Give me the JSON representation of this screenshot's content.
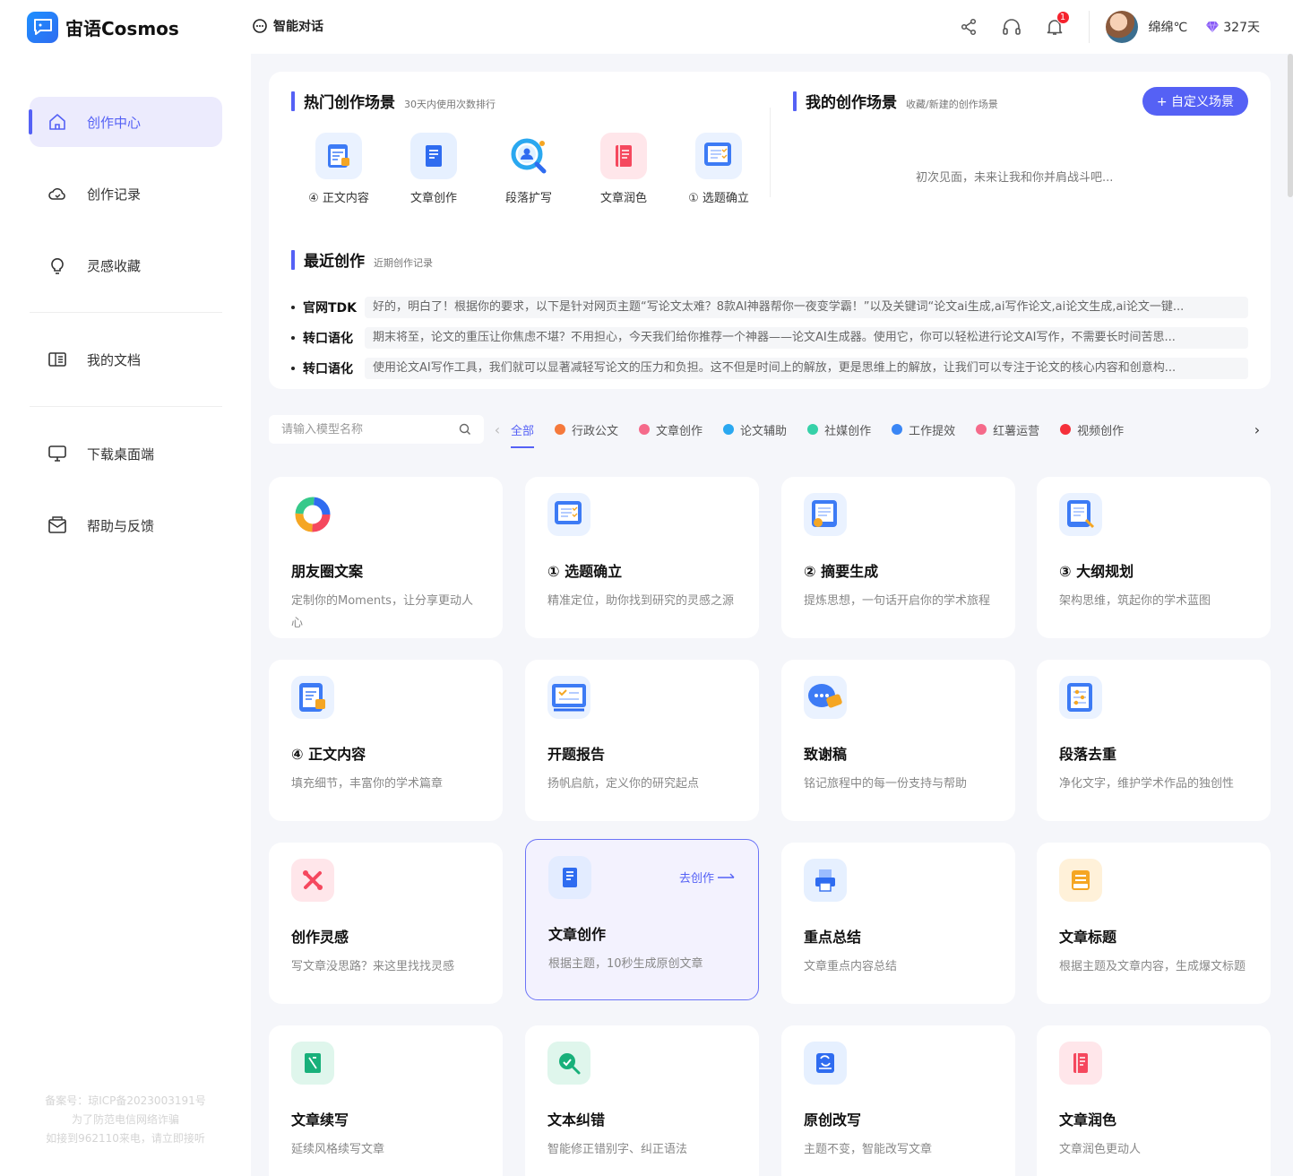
{
  "app": {
    "name": "宙语Cosmos",
    "chat_tab": "智能对话"
  },
  "user": {
    "name": "绵绵℃",
    "vip_days": "327天",
    "notification_count": "1"
  },
  "sidebar": {
    "items": [
      {
        "label": "创作中心",
        "icon": "home-icon"
      },
      {
        "label": "创作记录",
        "icon": "cloud-icon"
      },
      {
        "label": "灵感收藏",
        "icon": "bulb-icon"
      },
      {
        "label": "我的文档",
        "icon": "book-icon"
      },
      {
        "label": "下载桌面端",
        "icon": "monitor-icon"
      },
      {
        "label": "帮助与反馈",
        "icon": "mail-icon"
      }
    ],
    "footer": [
      "备案号：琼ICP备2023003191号",
      "为了防范电信网络诈骗",
      "如接到962110来电，请立即接听"
    ]
  },
  "hot": {
    "title": "热门创作场景",
    "subtitle": "30天内使用次数排行",
    "items": [
      "④ 正文内容",
      "文章创作",
      "段落扩写",
      "文章润色",
      "① 选题确立"
    ]
  },
  "mine": {
    "title": "我的创作场景",
    "subtitle": "收藏/新建的创作场景",
    "button": "+ 自定义场景",
    "empty": "初次见面，未来让我和你并肩战斗吧..."
  },
  "recent": {
    "title": "最近创作",
    "subtitle": "近期创作记录",
    "rows": [
      {
        "tag": "官网TDK",
        "text": "好的，明白了！根据你的要求，以下是针对网页主题“写论文太难？8款AI神器帮你一夜变学霸！”以及关键词“论文ai生成,ai写作论文,ai论文生成,ai论文一键..."
      },
      {
        "tag": "转口语化",
        "text": "期末将至，论文的重压让你焦虑不堪？不用担心，今天我们给你推荐一个神器——论文AI生成器。使用它，你可以轻松进行论文AI写作，不需要长时间苦思..."
      },
      {
        "tag": "转口语化",
        "text": "使用论文AI写作工具，我们就可以显著减轻写论文的压力和负担。这不但是时间上的解放，更是思维上的解放，让我们可以专注于论文的核心内容和创意构..."
      }
    ]
  },
  "filter": {
    "search_placeholder": "请输入模型名称",
    "categories": [
      {
        "label": "全部",
        "color": ""
      },
      {
        "label": "行政公文",
        "color": "#f5793b"
      },
      {
        "label": "文章创作",
        "color": "#f56a8a"
      },
      {
        "label": "论文辅助",
        "color": "#2aa8f0"
      },
      {
        "label": "社媒创作",
        "color": "#36d1a8"
      },
      {
        "label": "工作提效",
        "color": "#3a86f5"
      },
      {
        "label": "红薯运营",
        "color": "#f56a8a"
      },
      {
        "label": "视频创作",
        "color": "#f5303a"
      }
    ]
  },
  "cards": [
    {
      "title": "朋友圈文案",
      "desc": "定制你的Moments，让分享更动人心",
      "icon": "ring-icon"
    },
    {
      "title": "① 选题确立",
      "desc": "精准定位，助你找到研究的灵感之源",
      "icon": "doc-list-icon"
    },
    {
      "title": "② 摘要生成",
      "desc": "提炼思想，一句话开启你的学术旅程",
      "icon": "doc-check-icon"
    },
    {
      "title": "③ 大纲规划",
      "desc": "架构思维，筑起你的学术蓝图",
      "icon": "doc-pen-icon"
    },
    {
      "title": "④ 正文内容",
      "desc": "填充细节，丰富你的学术篇章",
      "icon": "doc-calendar-icon"
    },
    {
      "title": "开题报告",
      "desc": "扬帆启航，定义你的研究起点",
      "icon": "screen-icon"
    },
    {
      "title": "致谢稿",
      "desc": "铭记旅程中的每一份支持与帮助",
      "icon": "chat-icon"
    },
    {
      "title": "段落去重",
      "desc": "净化文字，维护学术作品的独创性",
      "icon": "doc-sliders-icon"
    },
    {
      "title": "创作灵感",
      "desc": "写文章没思路？来这里找找灵感",
      "icon": "spark-icon"
    },
    {
      "title": "文章创作",
      "desc": "根据主题，10秒生成原创文章",
      "icon": "notebook-icon",
      "action": "去创作"
    },
    {
      "title": "重点总结",
      "desc": "文章重点内容总结",
      "icon": "printer-icon"
    },
    {
      "title": "文章标题",
      "desc": "根据主题及文章内容，生成爆文标题",
      "icon": "title-icon"
    },
    {
      "title": "文章续写",
      "desc": "延续风格续写文章",
      "icon": "continue-icon"
    },
    {
      "title": "文本纠错",
      "desc": "智能修正错别字、纠正语法",
      "icon": "search-check-icon"
    },
    {
      "title": "原创改写",
      "desc": "主题不变，智能改写文章",
      "icon": "rewrite-icon"
    },
    {
      "title": "文章润色",
      "desc": "文章润色更动人",
      "icon": "polish-icon"
    }
  ],
  "colors": {
    "accent": "#5561f5",
    "active_bg": "#ecebfd"
  }
}
